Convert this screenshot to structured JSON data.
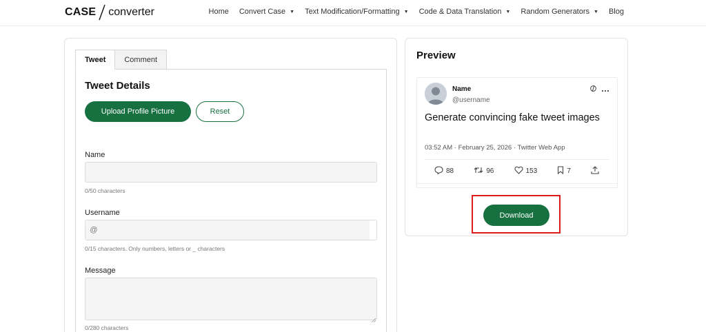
{
  "header": {
    "logo_part1": "CASE",
    "logo_part2": "converter",
    "nav": [
      {
        "label": "Home",
        "has_caret": false
      },
      {
        "label": "Convert Case",
        "has_caret": true
      },
      {
        "label": "Text Modification/Formatting",
        "has_caret": true
      },
      {
        "label": "Code & Data Translation",
        "has_caret": true
      },
      {
        "label": "Random Generators",
        "has_caret": true
      },
      {
        "label": "Blog",
        "has_caret": false
      }
    ],
    "caret_glyph": "▼"
  },
  "form": {
    "tabs": [
      "Tweet",
      "Comment"
    ],
    "active_tab": "Tweet",
    "section_title": "Tweet Details",
    "upload_label": "Upload Profile Picture",
    "reset_label": "Reset",
    "name_label": "Name",
    "name_value": "",
    "name_hint": "0/50 characters",
    "username_label": "Username",
    "username_prefix": "@",
    "username_value": "",
    "username_hint": "0/15 characters. Only numbers, letters or _ characters",
    "message_label": "Message",
    "message_value": "",
    "message_hint": "0/280 characters"
  },
  "preview": {
    "title": "Preview",
    "tweet": {
      "name": "Name",
      "username": "@username",
      "text": "Generate convincing fake tweet images",
      "meta": "03:52 AM · February 25, 2026 · Twitter Web App",
      "replies": "88",
      "retweets": "96",
      "likes": "153",
      "bookmarks": "7"
    },
    "download_label": "Download"
  },
  "colors": {
    "accent": "#16703f",
    "highlight": "#dd1a1a"
  },
  "icons": [
    "verified-icon",
    "more-icon",
    "reply-icon",
    "retweet-icon",
    "like-icon",
    "bookmark-icon",
    "share-icon"
  ]
}
